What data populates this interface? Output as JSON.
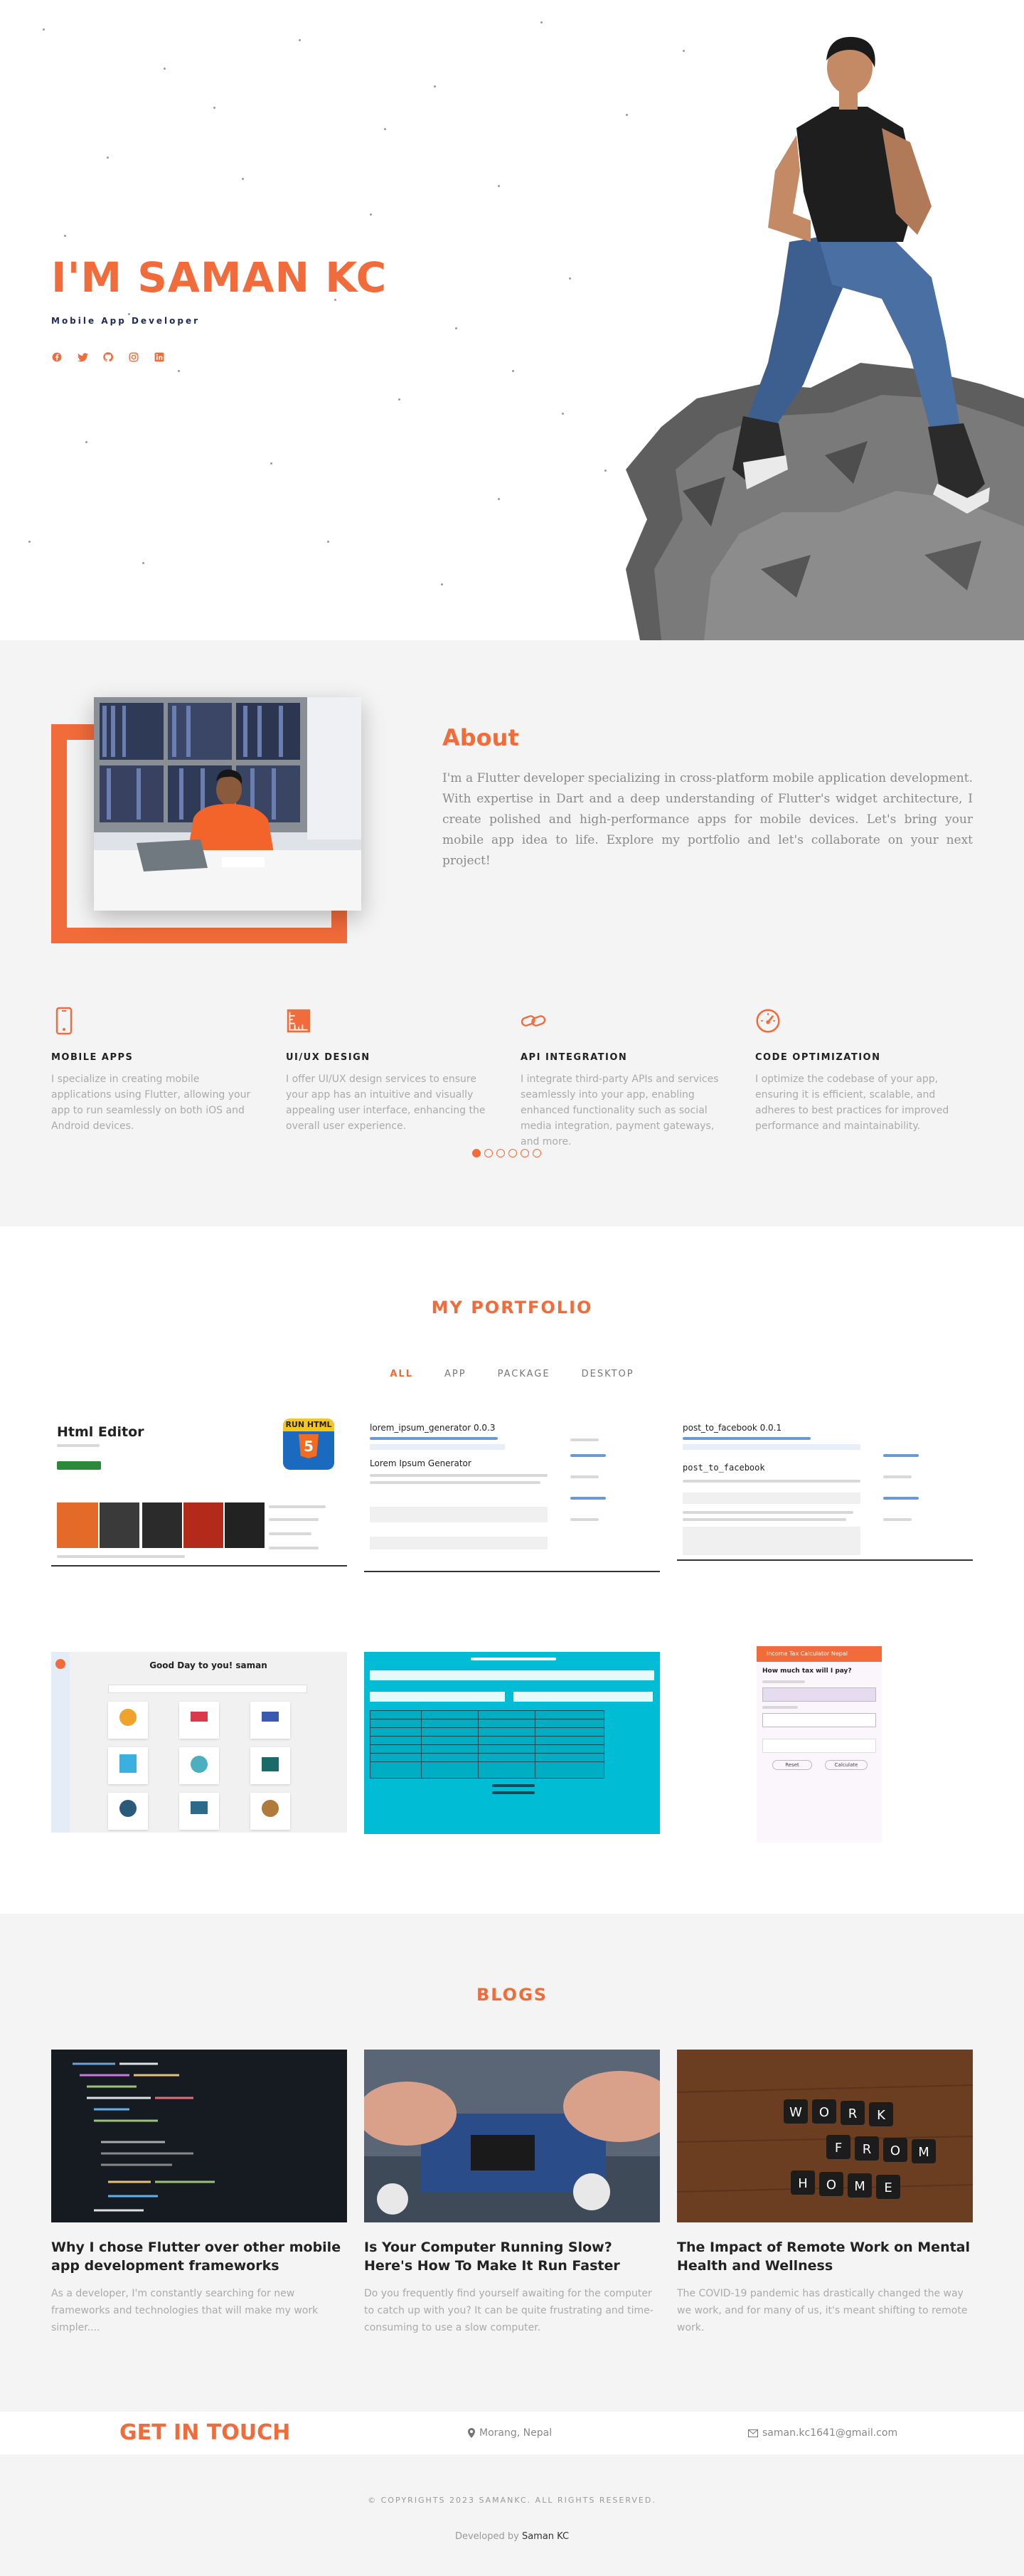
{
  "hero": {
    "title": "I'M SAMAN KC",
    "subtitle": "Mobile App Developer",
    "social": [
      "facebook-icon",
      "twitter-icon",
      "github-icon",
      "instagram-icon",
      "linkedin-icon"
    ]
  },
  "about": {
    "title": "About",
    "text": "I'm a Flutter developer specializing in cross-platform mobile application development. With expertise in Dart and a deep understanding of Flutter's widget architecture, I create polished and high-performance apps for mobile devices. Let's bring your mobile app idea to life. Explore my portfolio and let's collaborate on your next project!",
    "services": [
      {
        "title": "MOBILE APPS",
        "text": "I specialize in creating mobile applications using Flutter, allowing your app to run seamlessly on both iOS and Android devices."
      },
      {
        "title": "UI/UX DESIGN",
        "text": "I offer UI/UX design services to ensure your app has an intuitive and visually appealing user interface, enhancing the overall user experience."
      },
      {
        "title": "API INTEGRATION",
        "text": "I integrate third-party APIs and services seamlessly into your app, enabling enhanced functionality such as social media integration, payment gateways, and more."
      },
      {
        "title": "CODE OPTIMIZATION",
        "text": "I optimize the codebase of your app, ensuring it is efficient, scalable, and adheres to best practices for improved performance and maintainability."
      }
    ]
  },
  "portfolio": {
    "title": "MY PORTFOLIO",
    "filters": [
      "ALL",
      "APP",
      "PACKAGE",
      "DESKTOP"
    ],
    "items": {
      "html_editor": {
        "title": "Html Editor",
        "badge": "RUN HTML",
        "badge_num": "5"
      },
      "lorem": {
        "title": "lorem_ipsum_generator 0.0.3",
        "heading": "Lorem Ipsum Generator"
      },
      "facebook": {
        "title": "post_to_facebook 0.0.1",
        "heading": "post_to_facebook"
      },
      "goodday": {
        "title": "Good Day to you! saman"
      },
      "income": {
        "title": "Income Tax Calculator Nepal",
        "question": "How much tax will I pay?",
        "btn_reset": "Reset",
        "btn_calc": "Calculate"
      }
    }
  },
  "blogs": {
    "title": "BLOGS",
    "posts": [
      {
        "title": "Why I chose Flutter over other mobile app development frameworks",
        "text": "As a developer, I'm constantly searching for new frameworks and technologies that will make my work simpler...."
      },
      {
        "title": "Is Your Computer Running Slow? Here's How To Make It Run Faster",
        "text": "Do you frequently find yourself awaiting for the computer to catch up with you? It can be quite frustrating and time-consuming to use a slow computer."
      },
      {
        "title": "The Impact of Remote Work on Mental Health and Wellness",
        "text": "The COVID-19 pandemic has drastically changed the way we work, and for many of us, it's meant shifting to remote work."
      }
    ],
    "scrabble": [
      "W",
      "O",
      "R",
      "K",
      "F",
      "R",
      "O",
      "M",
      "H",
      "O",
      "M",
      "E"
    ]
  },
  "contact": {
    "title": "GET IN TOUCH",
    "location": "Morang, Nepal",
    "email": "saman.kc1641@gmail.com"
  },
  "footer": {
    "copyright": "© COPYRIGHTS 2023 SAMANKC. ALL RIGHTS RESERVED.",
    "developed_prefix": "Developed by",
    "developer": "Saman KC"
  }
}
